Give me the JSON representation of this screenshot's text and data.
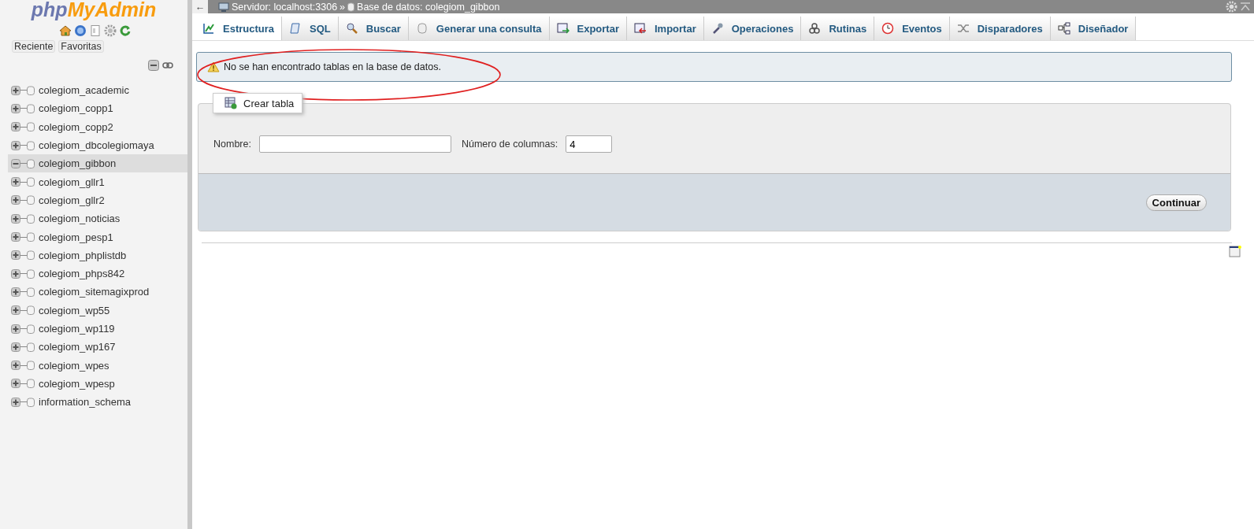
{
  "sidebar": {
    "logo": {
      "php": "php",
      "brand": "MyAdmin"
    },
    "tabs": [
      {
        "label": "Reciente",
        "selected": false
      },
      {
        "label": "Favoritas",
        "selected": false
      }
    ],
    "databases": [
      {
        "name": "colegiom_academic",
        "expanded": false,
        "selected": false
      },
      {
        "name": "colegiom_copp1",
        "expanded": false,
        "selected": false
      },
      {
        "name": "colegiom_copp2",
        "expanded": false,
        "selected": false
      },
      {
        "name": "colegiom_dbcolegiomaya",
        "expanded": false,
        "selected": false
      },
      {
        "name": "colegiom_gibbon",
        "expanded": true,
        "selected": true
      },
      {
        "name": "colegiom_gllr1",
        "expanded": false,
        "selected": false
      },
      {
        "name": "colegiom_gllr2",
        "expanded": false,
        "selected": false
      },
      {
        "name": "colegiom_noticias",
        "expanded": false,
        "selected": false
      },
      {
        "name": "colegiom_pesp1",
        "expanded": false,
        "selected": false
      },
      {
        "name": "colegiom_phplistdb",
        "expanded": false,
        "selected": false
      },
      {
        "name": "colegiom_phps842",
        "expanded": false,
        "selected": false
      },
      {
        "name": "colegiom_sitemagixprod",
        "expanded": false,
        "selected": false
      },
      {
        "name": "colegiom_wp55",
        "expanded": false,
        "selected": false
      },
      {
        "name": "colegiom_wp119",
        "expanded": false,
        "selected": false
      },
      {
        "name": "colegiom_wp167",
        "expanded": false,
        "selected": false
      },
      {
        "name": "colegiom_wpes",
        "expanded": false,
        "selected": false
      },
      {
        "name": "colegiom_wpesp",
        "expanded": false,
        "selected": false
      },
      {
        "name": "information_schema",
        "expanded": false,
        "selected": false
      }
    ]
  },
  "breadcrumb": {
    "back": "←",
    "server": "Servidor: localhost:3306",
    "separator": "»",
    "database": "Base de datos: colegiom_gibbon"
  },
  "tabs": [
    {
      "label": "Estructura",
      "selected": true
    },
    {
      "label": "SQL",
      "selected": false
    },
    {
      "label": "Buscar",
      "selected": false
    },
    {
      "label": "Generar una consulta",
      "selected": false
    },
    {
      "label": "Exportar",
      "selected": false
    },
    {
      "label": "Importar",
      "selected": false
    },
    {
      "label": "Operaciones",
      "selected": false
    },
    {
      "label": "Rutinas",
      "selected": false
    },
    {
      "label": "Eventos",
      "selected": false
    },
    {
      "label": "Disparadores",
      "selected": false
    },
    {
      "label": "Diseñador",
      "selected": false
    }
  ],
  "notice": {
    "text": "No se han encontrado tablas en la base de datos.",
    "highlighted": true
  },
  "create_table": {
    "legend": "Crear tabla",
    "name_label": "Nombre:",
    "columns_label": "Número de columnas:",
    "columns_value": "4",
    "button": "Continuar"
  }
}
